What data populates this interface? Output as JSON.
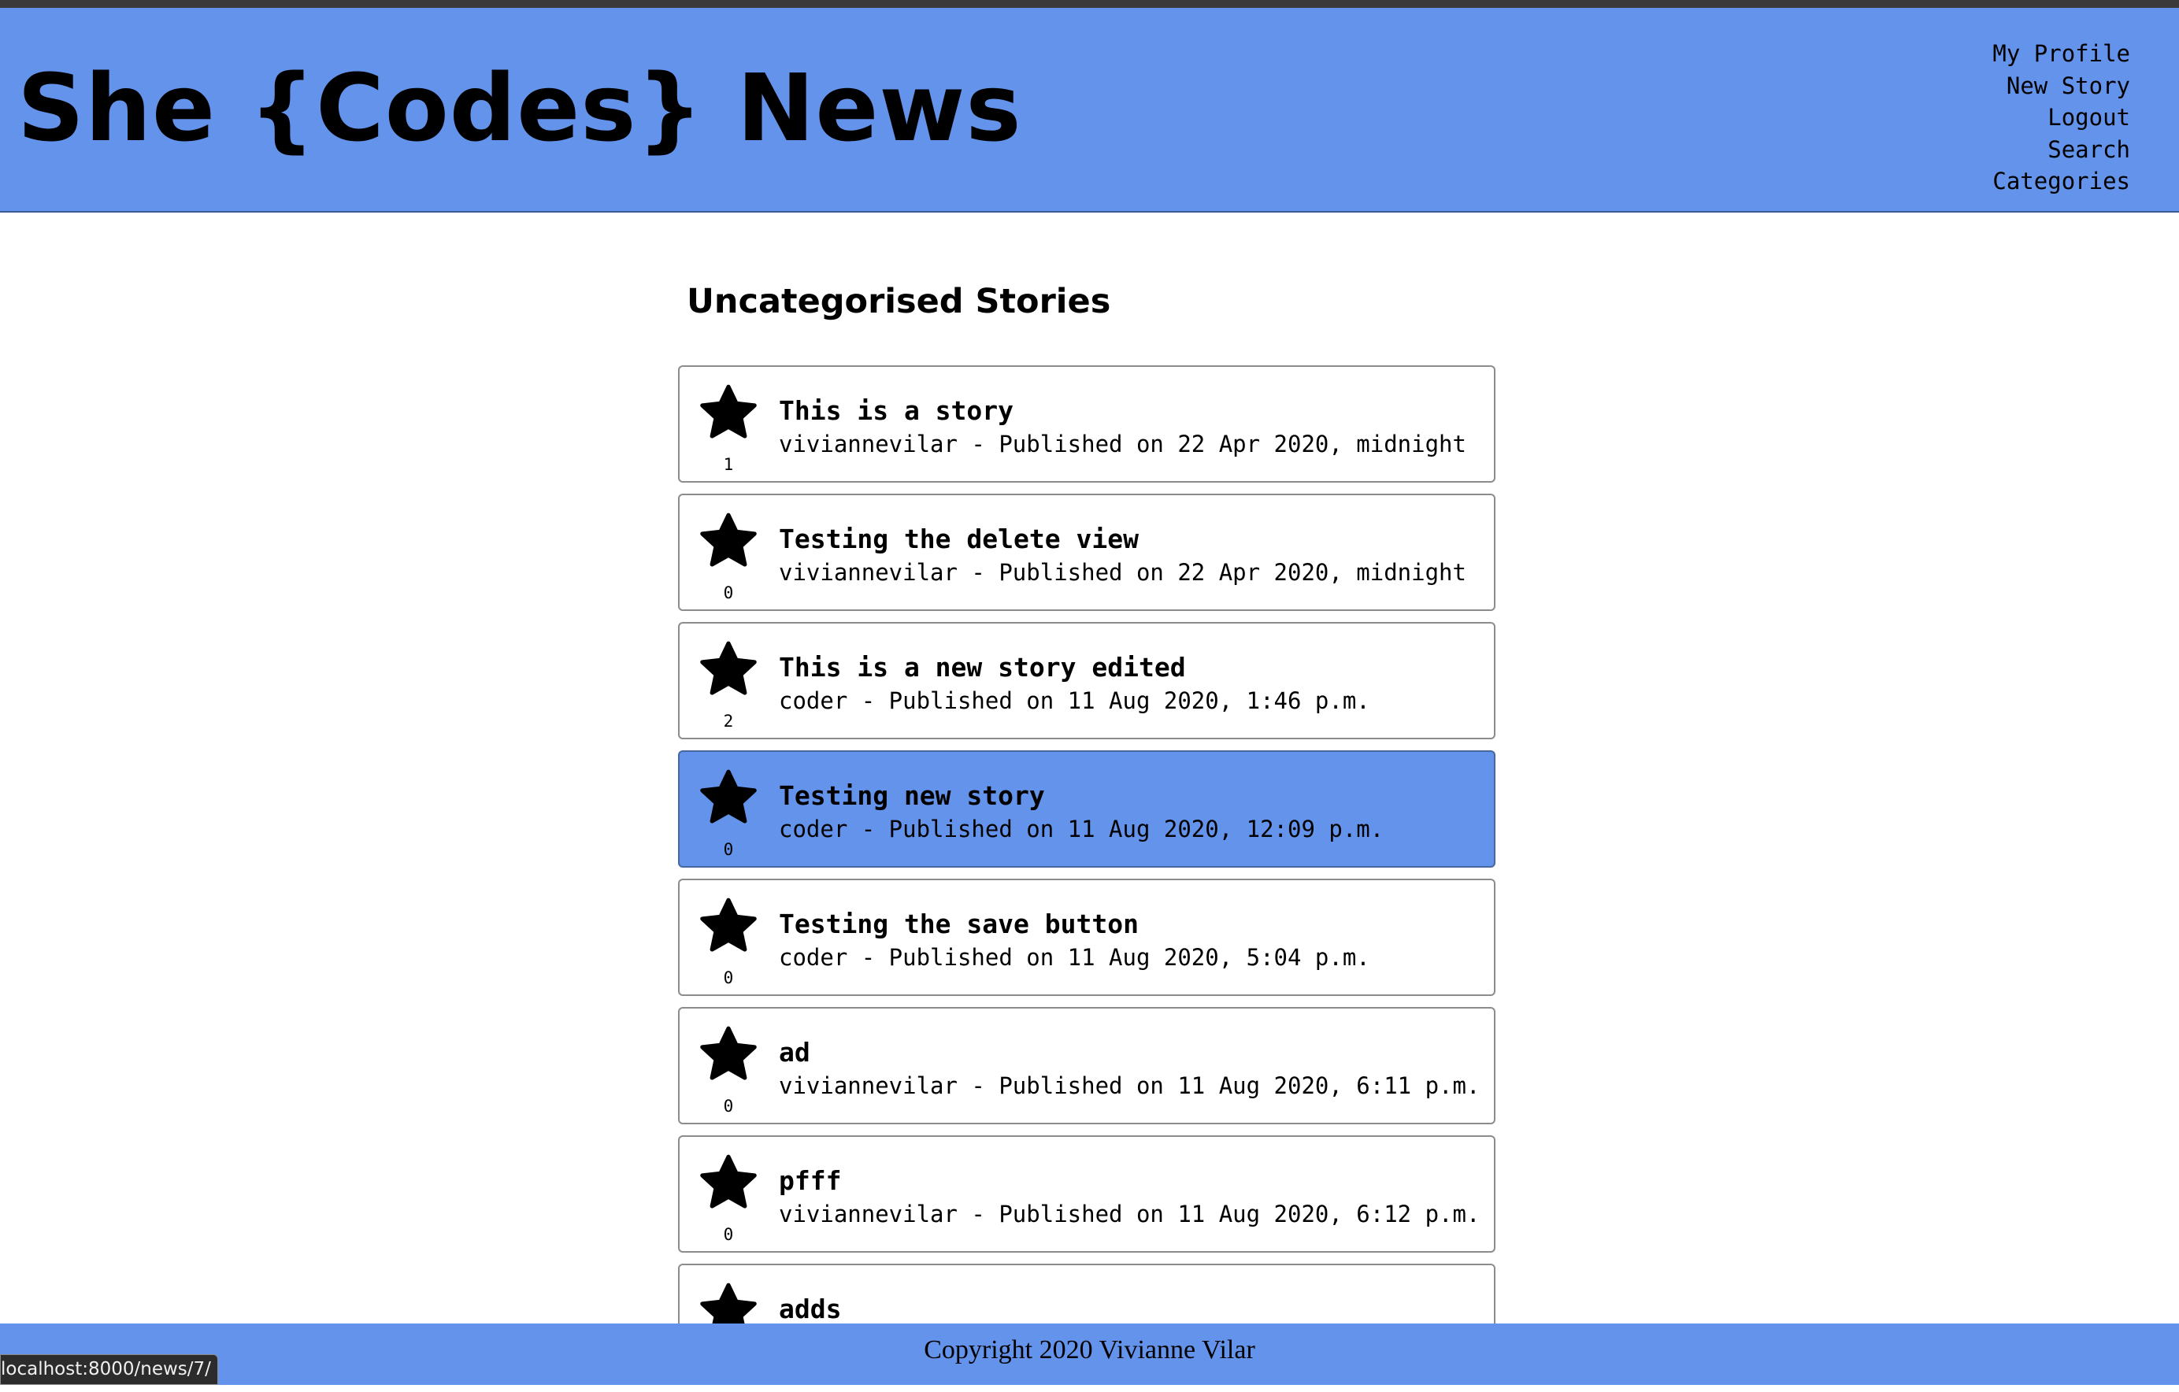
{
  "header": {
    "site_title": "She {Codes} News",
    "nav": [
      {
        "label": "My Profile",
        "name": "nav-my-profile"
      },
      {
        "label": "New Story",
        "name": "nav-new-story"
      },
      {
        "label": "Logout",
        "name": "nav-logout"
      },
      {
        "label": "Search",
        "name": "nav-search"
      },
      {
        "label": "Categories",
        "name": "nav-categories"
      }
    ]
  },
  "main": {
    "heading": "Uncategorised Stories",
    "stories": [
      {
        "title": "This is a story",
        "meta": "viviannevilar - Published on 22 Apr 2020, midnight",
        "stars": "1",
        "highlighted": false
      },
      {
        "title": "Testing the delete view",
        "meta": "viviannevilar - Published on 22 Apr 2020, midnight",
        "stars": "0",
        "highlighted": false
      },
      {
        "title": "This is a new story edited",
        "meta": "coder - Published on 11 Aug 2020, 1:46 p.m.",
        "stars": "2",
        "highlighted": false
      },
      {
        "title": "Testing new story",
        "meta": "coder - Published on 11 Aug 2020, 12:09 p.m.",
        "stars": "0",
        "highlighted": true
      },
      {
        "title": "Testing the save button",
        "meta": "coder - Published on 11 Aug 2020, 5:04 p.m.",
        "stars": "0",
        "highlighted": false
      },
      {
        "title": "ad",
        "meta": "viviannevilar - Published on 11 Aug 2020, 6:11 p.m.",
        "stars": "0",
        "highlighted": false
      },
      {
        "title": "pfff",
        "meta": "viviannevilar - Published on 11 Aug 2020, 6:12 p.m.",
        "stars": "0",
        "highlighted": false
      },
      {
        "title": "adds",
        "meta": "",
        "stars": "",
        "highlighted": false
      }
    ]
  },
  "footer": {
    "copyright": "Copyright 2020 Vivianne Vilar"
  },
  "status_bar": {
    "url": "localhost:8000/news/7/"
  },
  "colors": {
    "header_bg": "#6393ea",
    "highlight_bg": "#6393ea"
  },
  "icons": {
    "star": "star-icon"
  }
}
